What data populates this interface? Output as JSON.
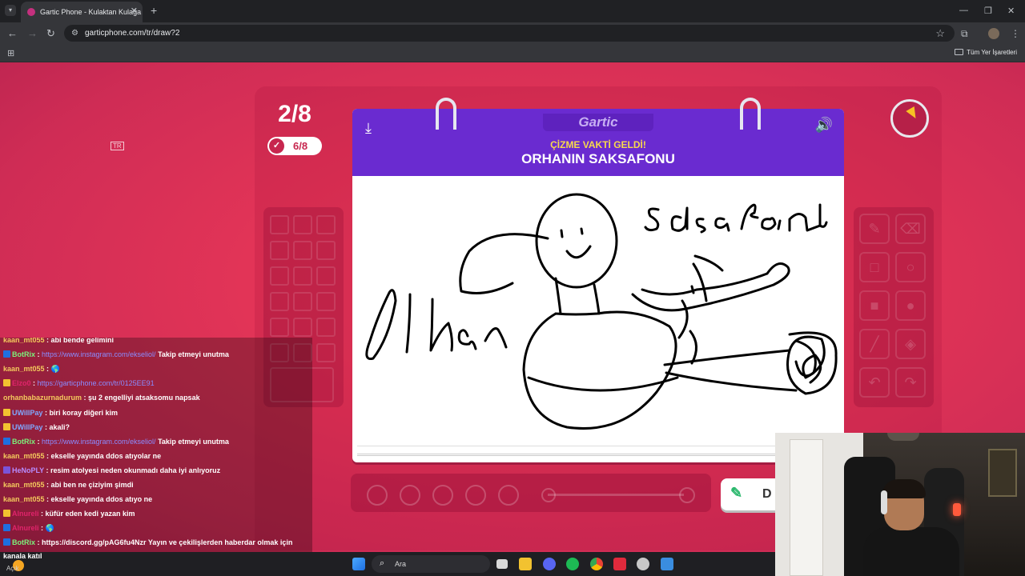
{
  "browser": {
    "tab_title": "Gartic Phone - Kulaktan Kulağa",
    "url": "garticphone.com/tr/draw?2",
    "all_bookmarks": "Tüm Yer İşaretleri"
  },
  "game": {
    "round": "2/8",
    "done_count": "6/8",
    "brand": "Gartic",
    "prompt_label": "ÇİZME VAKTİ GELDİ!",
    "prompt_word": "ORHANIN SAKSAFONU",
    "done_button_label": "D",
    "topic_badge": "TR",
    "timer_color": "#f7c223",
    "header_color": "#6a2bd0",
    "accent_color": "#f7d94c"
  },
  "chat": {
    "messages": [
      {
        "user": "kaan_mt055",
        "user_color": "#f4c95d",
        "text": "abi bende gelimini",
        "link": "",
        "badge": ""
      },
      {
        "user": "BotRix",
        "user_color": "#7cf07c",
        "text": "Takip etmeyi unutma",
        "link": "https://www.instagram.com/ekseliol/",
        "badge": "bot"
      },
      {
        "user": "kaan_mt055",
        "user_color": "#f4c95d",
        "text": "🌎",
        "link": "",
        "badge": ""
      },
      {
        "user": "Elzo0",
        "user_color": "#e0246b",
        "text": "",
        "link": "https://garticphone.com/tr/0125EE91",
        "badge": "sub"
      },
      {
        "user": "orhanbabazurnadurum",
        "user_color": "#f4c95d",
        "text": "şu 2 engelliyi atsaksomu napsak",
        "link": "",
        "badge": ""
      },
      {
        "user": "UWillPay",
        "user_color": "#7fa8ff",
        "text": "biri koray diğeri kim",
        "link": "",
        "badge": "sub"
      },
      {
        "user": "UWillPay",
        "user_color": "#7fa8ff",
        "text": "akali?",
        "link": "",
        "badge": "sub"
      },
      {
        "user": "BotRix",
        "user_color": "#7cf07c",
        "text": "Takip etmeyi unutma",
        "link": "https://www.instagram.com/ekseliol/",
        "badge": "bot"
      },
      {
        "user": "kaan_mt055",
        "user_color": "#f4c95d",
        "text": "ekselle yayında ddos atıyolar ne",
        "link": "",
        "badge": ""
      },
      {
        "user": "HeNoPLY",
        "user_color": "#b78cff",
        "text": "resim atolyesi neden okunmadı daha iyi anlıyoruz",
        "link": "",
        "badge": "mod"
      },
      {
        "user": "kaan_mt055",
        "user_color": "#f4c95d",
        "text": "abi ben ne çiziyim şimdi",
        "link": "",
        "badge": ""
      },
      {
        "user": "kaan_mt055",
        "user_color": "#f4c95d",
        "text": "ekselle yayında ddos atıyo ne",
        "link": "",
        "badge": ""
      },
      {
        "user": "Alnureli",
        "user_color": "#e0246b",
        "text": "küfür eden kedi yazan kim",
        "link": "",
        "badge": "sub"
      },
      {
        "user": "Alnureli",
        "user_color": "#e0246b",
        "text": "🌎",
        "link": "",
        "badge": "bot"
      },
      {
        "user": "BotRix",
        "user_color": "#7cf07c",
        "text": "https://discord.gg/pAG6fu4Nzr Yayın ve çekilişlerden haberdar olmak için",
        "link": "",
        "badge": "bot"
      }
    ],
    "footer": "kanala katıl"
  },
  "taskbar": {
    "search_placeholder": "Ara",
    "weather_temp": "",
    "weather_status": "Açık"
  }
}
